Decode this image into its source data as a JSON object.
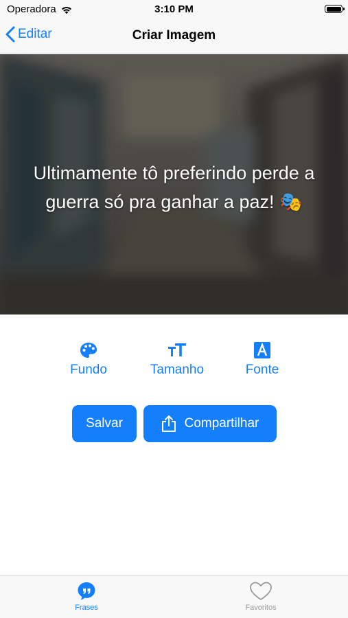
{
  "status_bar": {
    "carrier": "Operadora",
    "time": "3:10 PM"
  },
  "nav": {
    "back_label": "Editar",
    "title": "Criar Imagem"
  },
  "preview": {
    "quote_line1": "Ultimamente tô preferindo perde a",
    "quote_line2": "guerra só pra ganhar a paz! 🎭"
  },
  "tools": {
    "background_label": "Fundo",
    "size_label": "Tamanho",
    "font_label": "Fonte"
  },
  "actions": {
    "save_label": "Salvar",
    "share_label": "Compartilhar"
  },
  "tab_bar": {
    "phrases_label": "Frases",
    "favorites_label": "Favoritos"
  },
  "colors": {
    "accent": "#147efb",
    "tab_inactive": "#999999"
  }
}
